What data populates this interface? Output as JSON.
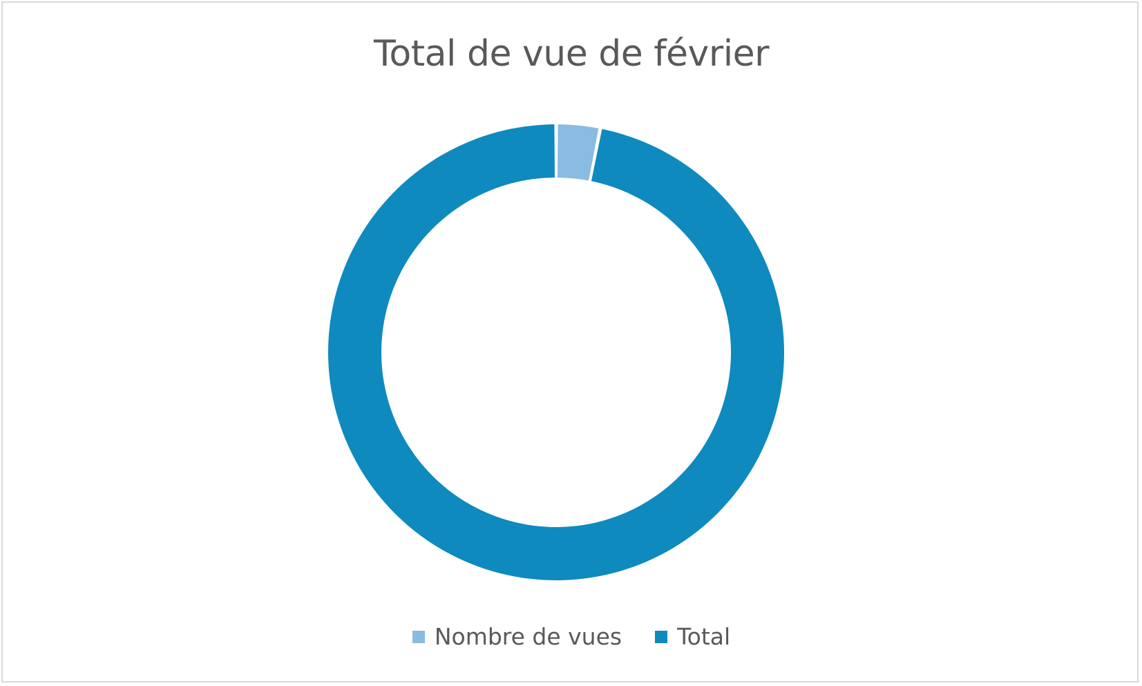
{
  "chart_data": {
    "type": "pie",
    "subtype": "doughnut",
    "title": "Total de vue de février",
    "categories": [
      "Nombre de vues",
      "Total"
    ],
    "values": [
      3.1,
      96.9
    ],
    "colors": [
      "#8abbe0",
      "#0e8abe"
    ],
    "legend": {
      "position": "bottom",
      "items": [
        {
          "label": "Nombre de vues",
          "color": "#8abbe0"
        },
        {
          "label": "Total",
          "color": "#0e8abe"
        }
      ]
    }
  }
}
